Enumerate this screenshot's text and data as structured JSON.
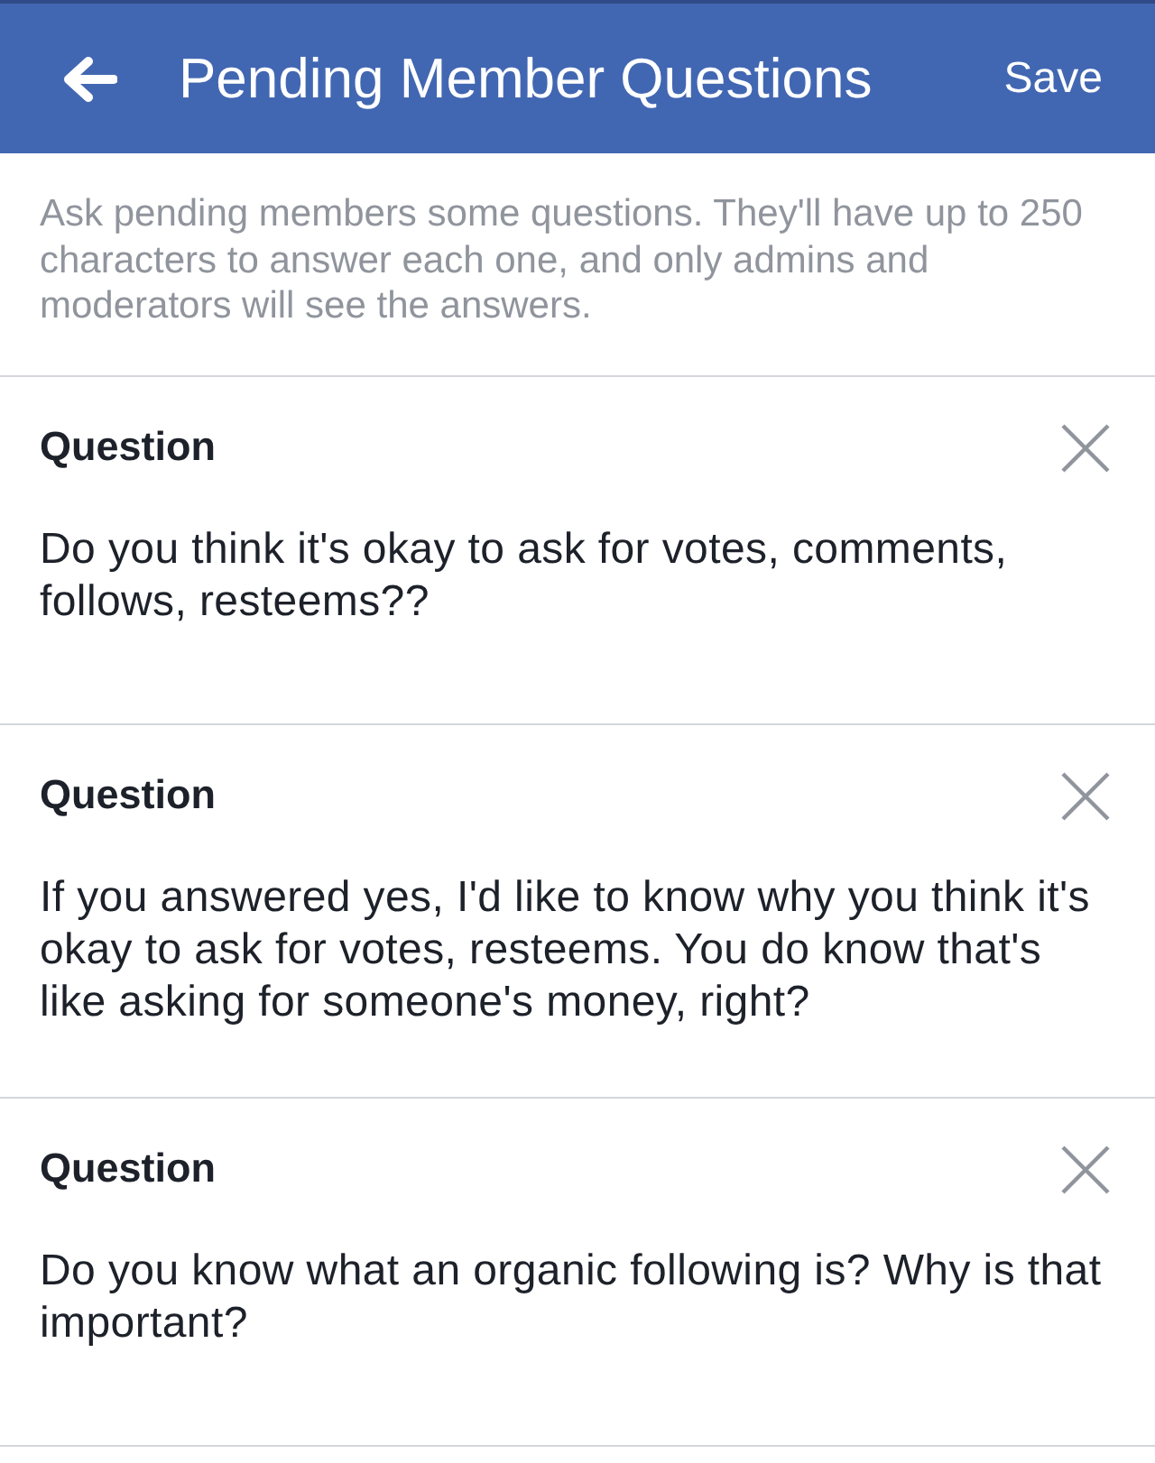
{
  "header": {
    "title": "Pending Member Questions",
    "action": "Save"
  },
  "description": "Ask pending members some questions. They'll have up to 250 characters to answer each one, and only admins and moderators will see the answers.",
  "questions": [
    {
      "label": "Question",
      "text": "Do you think it's okay to ask for votes, comments, follows, resteems??"
    },
    {
      "label": "Question",
      "text": "If you answered yes, I'd like to know why you think it's okay to ask for votes, resteems. You do know that's like asking for someone's money, right?"
    },
    {
      "label": "Question",
      "text": "Do you know what an organic following is? Why is that important?"
    }
  ]
}
